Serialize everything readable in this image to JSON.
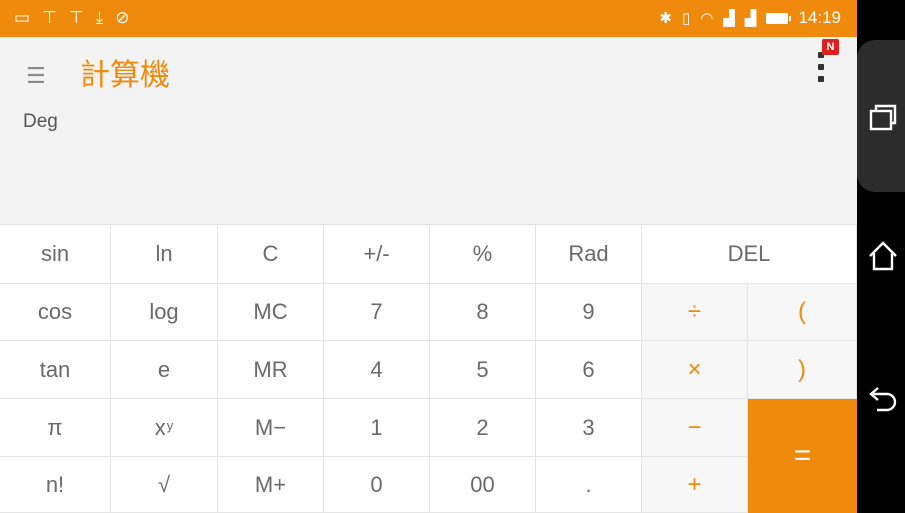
{
  "statusbar": {
    "left_icons": [
      "image-icon",
      "notification-icon",
      "notification-icon",
      "download-icon",
      "blocked-icon"
    ],
    "time": "14:19"
  },
  "appbar": {
    "title": "計算機",
    "badge": "N"
  },
  "display": {
    "mode": "Deg",
    "value": ""
  },
  "keypad": {
    "rows": [
      [
        "sin",
        "ln",
        "C",
        "+/-",
        "%",
        "Rad",
        "DEL"
      ],
      [
        "cos",
        "log",
        "MC",
        "7",
        "8",
        "9",
        "÷",
        "("
      ],
      [
        "tan",
        "e",
        "MR",
        "4",
        "5",
        "6",
        "×",
        ")"
      ],
      [
        "π",
        "x",
        "M−",
        "1",
        "2",
        "3",
        "−",
        "="
      ],
      [
        "n!",
        "√",
        "M+",
        "0",
        "00",
        ".",
        "+"
      ]
    ],
    "power_superscript": "y"
  },
  "colors": {
    "accent": "#ef8a0d",
    "status_bar": "#ef8a0d",
    "badge": "#e01f1f",
    "background": "#f3f3f3"
  }
}
